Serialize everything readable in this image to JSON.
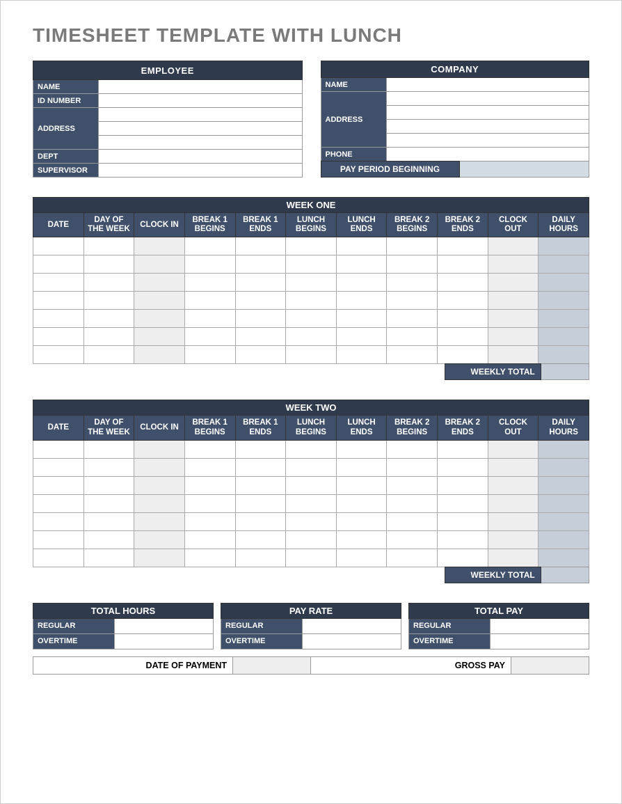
{
  "title": "TIMESHEET TEMPLATE WITH LUNCH",
  "employee_section": {
    "header": "EMPLOYEE",
    "fields": {
      "name_label": "NAME",
      "id_label": "ID NUMBER",
      "address_label": "ADDRESS",
      "dept_label": "DEPT",
      "supervisor_label": "SUPERVISOR",
      "name": "",
      "id": "",
      "addr1": "",
      "addr2": "",
      "addr3": "",
      "dept": "",
      "supervisor": ""
    }
  },
  "company_section": {
    "header": "COMPANY",
    "fields": {
      "name_label": "NAME",
      "address_label": "ADDRESS",
      "phone_label": "PHONE",
      "name": "",
      "addr1": "",
      "addr2": "",
      "addr3": "",
      "addr4": "",
      "phone": ""
    },
    "pay_period_label": "PAY PERIOD BEGINNING",
    "pay_period_value": ""
  },
  "week_columns": [
    "DATE",
    "DAY OF THE WEEK",
    "CLOCK IN",
    "BREAK 1 BEGINS",
    "BREAK 1 ENDS",
    "LUNCH BEGINS",
    "LUNCH ENDS",
    "BREAK 2 BEGINS",
    "BREAK 2 ENDS",
    "CLOCK OUT",
    "DAILY HOURS"
  ],
  "week_one": {
    "title": "WEEK ONE",
    "weekly_total_label": "WEEKLY TOTAL",
    "weekly_total": ""
  },
  "week_two": {
    "title": "WEEK TWO",
    "weekly_total_label": "WEEKLY TOTAL",
    "weekly_total": ""
  },
  "summary": {
    "total_hours_header": "TOTAL HOURS",
    "pay_rate_header": "PAY RATE",
    "total_pay_header": "TOTAL PAY",
    "regular_label": "REGULAR",
    "overtime_label": "OVERTIME",
    "total_hours": {
      "regular": "",
      "overtime": ""
    },
    "pay_rate": {
      "regular": "",
      "overtime": ""
    },
    "total_pay": {
      "regular": "",
      "overtime": ""
    }
  },
  "footer": {
    "date_of_payment_label": "DATE OF PAYMENT",
    "date_of_payment": "",
    "gross_pay_label": "GROSS PAY",
    "gross_pay": ""
  }
}
